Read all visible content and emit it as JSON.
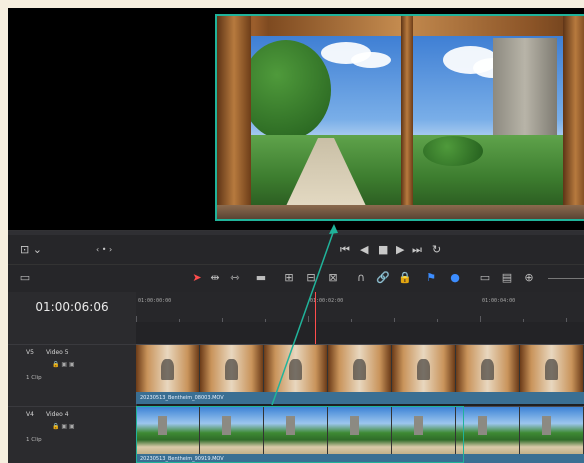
{
  "timeline": {
    "timecode": "01:00:06:06",
    "ruler_marks": [
      "01:00:00:00",
      "01:00:02:00",
      "01:00:04:00"
    ]
  },
  "tracks": [
    {
      "id": "V5",
      "name": "Video 5",
      "clip_count": "1 Clip",
      "clip_name": "20230513_Bentheim_08003.MOV"
    },
    {
      "id": "V4",
      "name": "Video 4",
      "clip_count": "1 Clip",
      "clip_name": "20230513_Bentheim_90919.MOV"
    }
  ],
  "colors": {
    "accent": "#20b39a",
    "playhead": "#ff4d4d",
    "clip_bar": "#3a6f93",
    "panel": "#262629",
    "background": "#1f1f21"
  },
  "icons": {
    "transport": [
      "go-to-start-icon",
      "step-back-icon",
      "stop-icon",
      "play-icon",
      "go-to-end-icon",
      "loop-icon"
    ],
    "edit_tools": [
      "selection-tool-icon",
      "trim-tool-icon",
      "dynamic-trim-icon",
      "blade-tool-icon",
      "insert-icon",
      "overwrite-icon",
      "replace-icon",
      "snapping-icon",
      "linked-selection-icon",
      "position-lock-icon",
      "flag-icon",
      "marker-icon",
      "zoom-full-icon",
      "zoom-detail-icon",
      "zoom-custom-icon"
    ]
  }
}
